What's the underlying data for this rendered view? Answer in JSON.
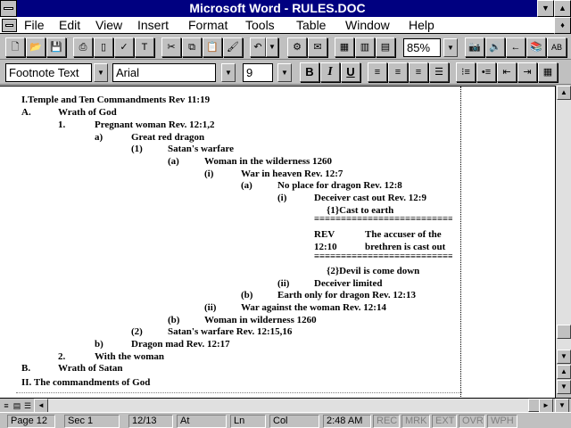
{
  "window": {
    "title": "Microsoft Word - RULES.DOC"
  },
  "menu": [
    {
      "label": "File",
      "key": "F"
    },
    {
      "label": "Edit",
      "key": "E"
    },
    {
      "label": "View",
      "key": "V"
    },
    {
      "label": "Insert",
      "key": "I"
    },
    {
      "label": "Format",
      "key": "o"
    },
    {
      "label": "Tools",
      "key": "T"
    },
    {
      "label": "Table",
      "key": "a"
    },
    {
      "label": "Window",
      "key": "W"
    },
    {
      "label": "Help",
      "key": "H"
    }
  ],
  "toolbar": {
    "zoom": "85%"
  },
  "formatting": {
    "style": "Footnote Text",
    "font": "Arial",
    "size": "9",
    "bold_label": "B",
    "italic_label": "I",
    "underline_label": "U"
  },
  "document": {
    "lines": [
      {
        "text": "I.Temple and Ten Commandments  Rev 11:19"
      },
      {
        "label": "A.",
        "text": "Wrath of God"
      },
      {
        "label": "1.",
        "text": "Pregnant woman  Rev. 12:1,2"
      },
      {
        "label": "a)",
        "text": "Great red dragon"
      },
      {
        "label": "(1)",
        "text": "Satan's warfare"
      },
      {
        "label": "(a)",
        "text": "Woman in the wilderness 1260"
      },
      {
        "label": "(i)",
        "text": "War in heaven  Rev. 12:7"
      },
      {
        "label": "(a)",
        "text": "No place for dragon  Rev. 12:8"
      },
      {
        "label": "(i)",
        "text": "Deceiver cast out  Rev. 12:9"
      },
      {
        "text": "{1}Cast to earth"
      },
      {
        "text": "REV"
      },
      {
        "text": "The accuser of the"
      },
      {
        "text": "12:10"
      },
      {
        "text": "brethren is cast out"
      },
      {
        "text": "{2}Devil is come down"
      },
      {
        "label": "(ii)",
        "text": "Deceiver limited"
      },
      {
        "label": "(b)",
        "text": "Earth only for dragon  Rev. 12:13"
      },
      {
        "label": "(ii)",
        "text": "War against the woman  Rev. 12:14"
      },
      {
        "label": "(b)",
        "text": "Woman in wilderness 1260"
      },
      {
        "label": "(2)",
        "text": "Satan's warfare  Rev. 12:15,16"
      },
      {
        "label": "b)",
        "text": "Dragon mad  Rev. 12:17"
      },
      {
        "label": "2.",
        "text": "With the woman"
      },
      {
        "label": "B.",
        "text": "Wrath of Satan"
      },
      {
        "text": "II. The commandments of God"
      }
    ]
  },
  "status": {
    "page": "Page 12",
    "sec": "Sec 1",
    "pos": "12/13",
    "at": "At",
    "ln": "Ln",
    "col": "Col",
    "time": "2:48 AM",
    "rec": "REC",
    "mrk": "MRK",
    "ext": "EXT",
    "ovr": "OVR",
    "wph": "WPH"
  }
}
